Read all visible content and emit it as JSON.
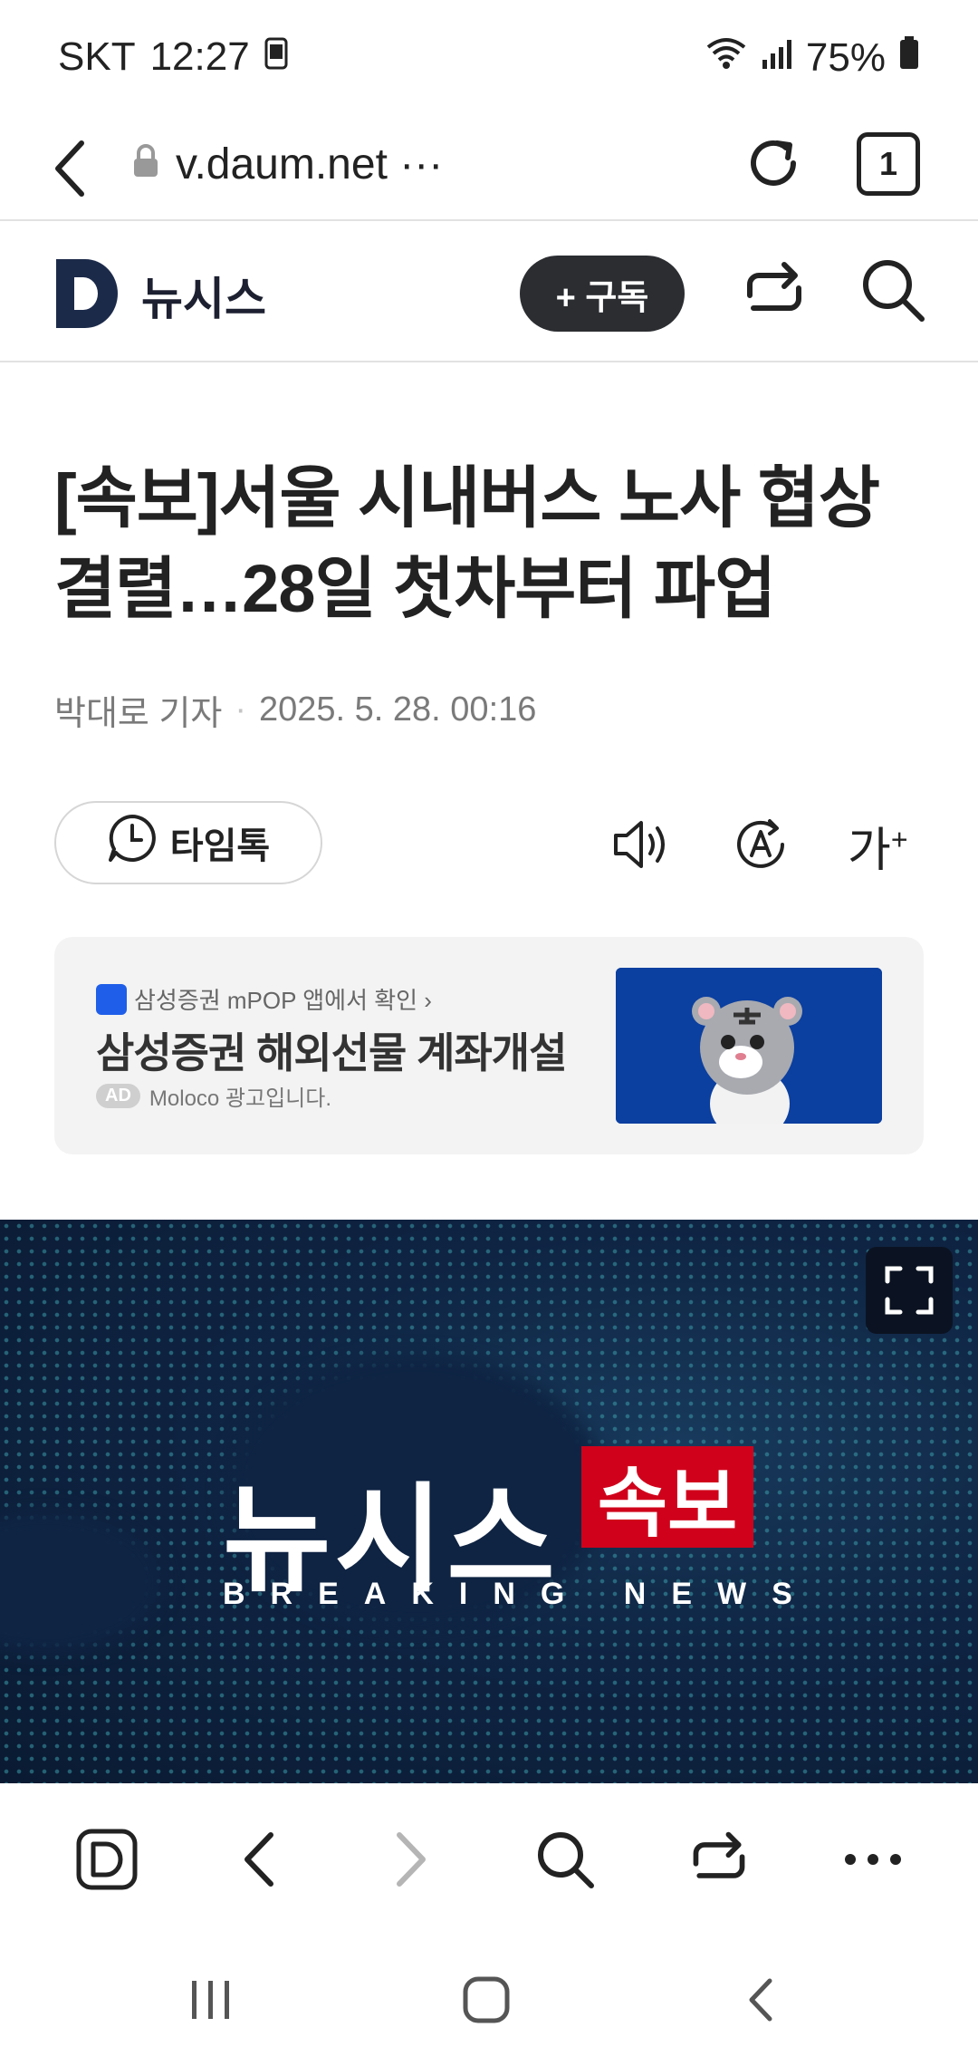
{
  "status_bar": {
    "carrier": "SKT",
    "time": "12:27",
    "battery": "75%"
  },
  "browser": {
    "url": "v.daum.net ···",
    "tab_count": "1"
  },
  "site": {
    "name": "뉴시스",
    "subscribe_label": "+ 구독"
  },
  "article": {
    "headline_line1": "[속보]서울 시내버스 노사 협상",
    "headline_line2": "결렬…28일 첫차부터 파업",
    "author": "박대로 기자",
    "separator": "·",
    "datetime": "2025. 5. 28. 00:16",
    "timetalk_label": "타임톡",
    "font_size_label": "가"
  },
  "ad": {
    "brand_line": "삼성증권 mPOP 앱에서 확인 ›",
    "title": "삼성증권 해외선물 계좌개설",
    "badge": "AD",
    "disclaimer": "Moloco 광고입니다."
  },
  "hero_image": {
    "logo_text": "뉴시스",
    "badge_text": "속보",
    "subtitle": "BREAKING NEWS"
  },
  "colors": {
    "subscribe_bg": "#2b2d31",
    "hero_bg": "#0f2443",
    "breaking_red": "#d0021b",
    "ad_bg": "#f3f3f3",
    "logo_navy": "#1c2a4a"
  }
}
